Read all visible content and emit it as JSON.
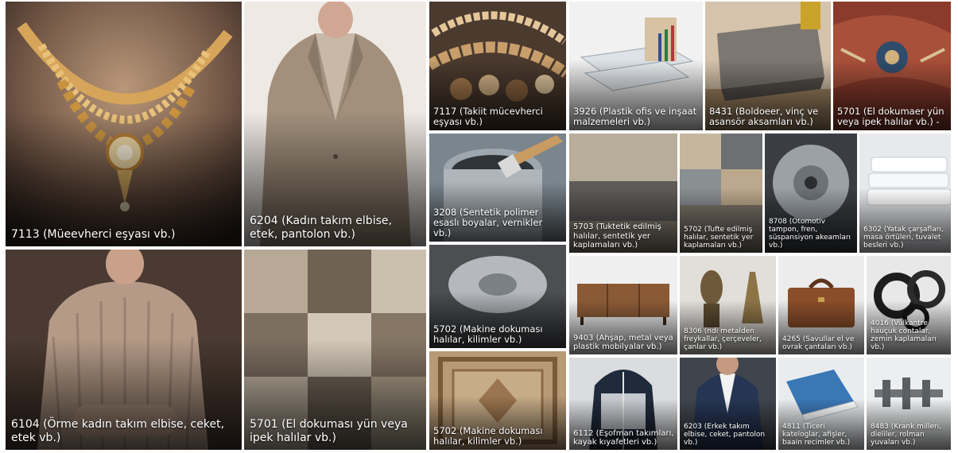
{
  "tiles": {
    "t7113": "7113 (Müeevherci eşyası vb.)",
    "t6204": "6204 (Kadın takım elbise, etek, pantolon vb.)",
    "t6104": "6104 (Örme kadın takım elbise, ceket, etek vb.)",
    "t5701a": "5701 (El dokuması yün veya ipek halılar vb.)",
    "t7117": "7117 (Takiit mücevherci eşyası vb.)",
    "t3926": "3926 (Plastik ofis ve inşaat malzemeleri vb.)",
    "t8431": "8431 (Boldoeer, vinç ve asansör aksamları vb.)",
    "t5701b": "5701 (El dokumaer yün veya ipek halılar vb.) -",
    "t3208": "3208 (Sentetik polimer esaslı boyalar, vernikler vb.)",
    "t5703": "5703 (Tuktetik edilmiş halılar, sentetik yer kaplamaları vb.)",
    "t5702a": "5702 (Tufte edilmiş halılar, sentetik yer kaplamaları vb.)",
    "t8708": "8708 (Otomotiv tampon, fren, süspansiyon akeamları vb.)",
    "t6302": "6302 (Yatak çarşafları, masa örtüleri, tuvalet besleri vb.)",
    "t5702b": "5702 (Makine dokuması halılar, kilimler vb.)",
    "t9403": "9403 (Ahşap, metal veya plastik mobilyalar vb.)",
    "t8306": "8306 (ndi metalden freykallar, çerçeveler, çanlar vb.)",
    "t4202": "4265 (Savullar el ve ovrak çantaları vb.)",
    "t4016": "4016 (Vulkantre hauçuk contalar, zemin kaplamaları vb.)",
    "t5702c": "5702 (Makine dokuması halılar, kilimler vb.)",
    "t6112": "6112 (Eşofman takımları, kayak kıyafetleri vb.)",
    "t6203": "6203 (Erkek takım elbise, ceket, pantolon vb.)",
    "t4911": "4811 (Ticeri kateloglar, afişler, baain recimler vb.)",
    "t8483": "8483 (Krank milleri, dieliler, rolman yuvaları vb.)"
  }
}
